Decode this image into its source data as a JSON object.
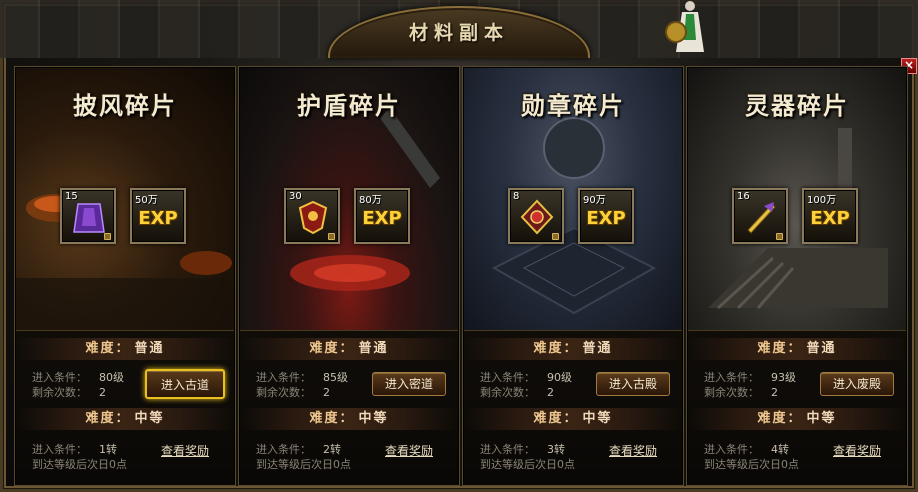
{
  "window": {
    "title": "材料副本",
    "close_label": "×"
  },
  "labels": {
    "difficulty": "难度：",
    "entry_condition": "进入条件：",
    "remaining": "剩余次数：",
    "reset_note": "到达等级后次日0点",
    "exp": "EXP",
    "view_reward": "查看奖励"
  },
  "panels": [
    {
      "title": "披风碎片",
      "item_count": "15",
      "exp_amount": "50万",
      "normal": {
        "difficulty": "普通",
        "level": "80级",
        "remaining": "2",
        "button": "进入古道"
      },
      "mid": {
        "difficulty": "中等",
        "level": "1转"
      }
    },
    {
      "title": "护盾碎片",
      "item_count": "30",
      "exp_amount": "80万",
      "normal": {
        "difficulty": "普通",
        "level": "85级",
        "remaining": "2",
        "button": "进入密道"
      },
      "mid": {
        "difficulty": "中等",
        "level": "2转"
      }
    },
    {
      "title": "勋章碎片",
      "item_count": "8",
      "exp_amount": "90万",
      "normal": {
        "difficulty": "普通",
        "level": "90级",
        "remaining": "2",
        "button": "进入古殿"
      },
      "mid": {
        "difficulty": "中等",
        "level": "3转"
      }
    },
    {
      "title": "灵器碎片",
      "item_count": "16",
      "exp_amount": "100万",
      "normal": {
        "difficulty": "普通",
        "level": "93级",
        "remaining": "2",
        "button": "进入废殿"
      },
      "mid": {
        "difficulty": "中等",
        "level": "4转"
      }
    }
  ],
  "icons": [
    "cloak-shard-icon",
    "shield-shard-icon",
    "medal-shard-icon",
    "spirit-weapon-shard-icon",
    "exp-icon",
    "lock-icon",
    "close-icon"
  ],
  "colors": {
    "gold": "#ffd23a",
    "frame": "#8a6e3a",
    "highlight": "#e8c020"
  }
}
